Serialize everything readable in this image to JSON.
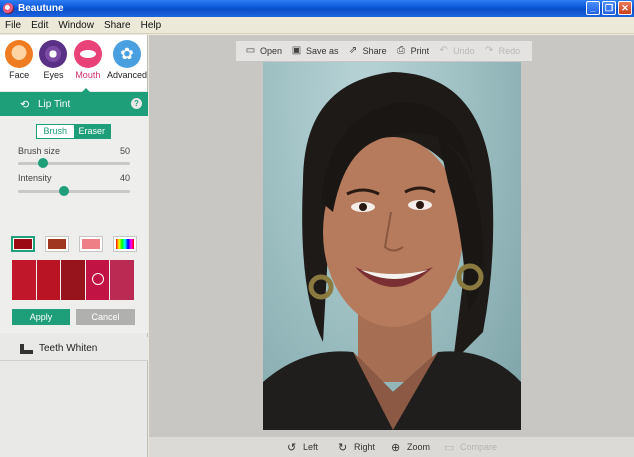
{
  "window": {
    "title": "Beautune",
    "min_label": "_",
    "max_label": "❐",
    "close_label": "✕"
  },
  "menu": [
    "File",
    "Edit",
    "Window",
    "Share",
    "Help"
  ],
  "categories": [
    {
      "label": "Face"
    },
    {
      "label": "Eyes"
    },
    {
      "label": "Mouth"
    },
    {
      "label": "Advanced"
    }
  ],
  "lip_tint": {
    "title": "Lip Tint",
    "help": "?",
    "mode_tabs": [
      "Brush",
      "Eraser"
    ],
    "active_mode": "Brush",
    "brush_size": {
      "label": "Brush size",
      "value": "50",
      "fraction": 0.2
    },
    "intensity": {
      "label": "Intensity",
      "value": "40",
      "fraction": 0.4
    },
    "swatches": [
      "#9b0a12",
      "#a0361f",
      "#ef7f86",
      "rainbow"
    ],
    "palette": [
      "#c0172b",
      "#b91424",
      "#97141c",
      "#c21444",
      "#bb2a52"
    ],
    "selected_palette_index": 3,
    "apply_label": "Apply",
    "cancel_label": "Cancel"
  },
  "teeth_whiten": {
    "label": "Teeth Whiten"
  },
  "toolbar": {
    "open": "Open",
    "saveas": "Save as",
    "share": "Share",
    "print": "Print",
    "undo": "Undo",
    "redo": "Redo"
  },
  "bottom": {
    "left": "Left",
    "right": "Right",
    "zoom": "Zoom",
    "compare": "Compare"
  },
  "colors": {
    "accent": "#1e9e79",
    "mouth_active": "#d1306b"
  }
}
